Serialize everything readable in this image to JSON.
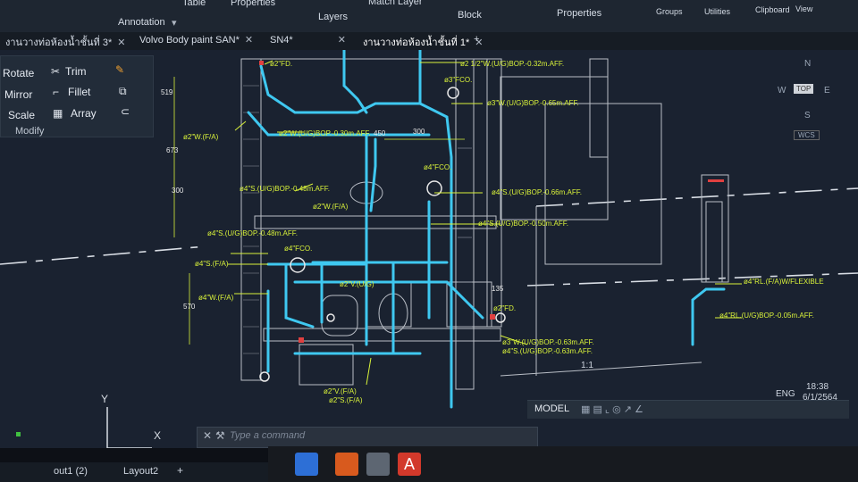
{
  "ribbon": {
    "groups": [
      "Annotation",
      "Layers",
      "Block",
      "Properties",
      "Groups",
      "Utilities",
      "Clipboard",
      "View"
    ],
    "top_items": [
      "Table",
      "Properties",
      "Match Layer"
    ]
  },
  "file_tabs": [
    {
      "label": "งานวางท่อห้องน้ำชั้นที่ 3*"
    },
    {
      "label": "Volvo Body paint SAN*"
    },
    {
      "label": "SN4*"
    },
    {
      "label": "งานวางท่อห้องน้ำชั้นที่ 1*"
    }
  ],
  "modify_panel": {
    "title": "Modify",
    "tools": [
      "Rotate",
      "Trim",
      "Mirror",
      "Fillet",
      "Scale",
      "Array"
    ]
  },
  "viewcube": {
    "n": "N",
    "w": "W",
    "e": "E",
    "s": "S",
    "top": "TOP",
    "wcs": "WCS"
  },
  "drawing": {
    "annotations_yellow": [
      "ø2\"FD.",
      "ø2 1/2\"W.(U/G)BOP.-0.32m.AFF.",
      "ø3\"FCO.",
      "ø3\"W.(U/G)BOP.-0.65m.AFF.",
      "ø2\"W.(F/A)",
      "ø2\"W.(U/G)BOP.-0.30m.AFF.",
      "ø4\"FCO.",
      "ø4\"S.(U/G)BOP.-0.48m.AFF.",
      "ø4\"S.(U/G)BOP.-0.66m.AFF.",
      "ø2\"W.(F/A)",
      "ø4\"S.(U/G)BOP.-0.48m.AFF.",
      "ø4\"S.(U/G)BOP.-0.50m.AFF.",
      "ø4\"FCO.",
      "ø4\"S.(F/A)",
      "ø2\"V.(U/G)",
      "ø4\"W.(F/A)",
      "ø2\"FD.",
      "ø3\"W.(U/G)BOP.-0.63m.AFF.",
      "ø4\"S.(U/G)BOP.-0.63m.AFF.",
      "ø2\"V.(F/A)",
      "ø2\"S.(F/A)",
      "ø4\"RL.(F/A)W/FLEXIBLE",
      "ø4\"RL.(U/G)BOP.-0.05m.AFF."
    ],
    "dimensions": [
      "519",
      "673",
      "450",
      "300",
      "300",
      "570",
      "135"
    ]
  },
  "command_line": {
    "placeholder": "Type a command"
  },
  "status_bar": {
    "model": "MODEL",
    "scale": "1:1"
  },
  "layout_tabs": [
    "out1 (2)",
    "Layout2",
    "+"
  ],
  "system_tray": {
    "lang": "ENG",
    "time": "18:38",
    "date": "6/1/2564"
  },
  "colors": {
    "pipe": "#3fc8f0",
    "annotation": "#d9f23a",
    "wall": "#c8c8c8",
    "background": "#1a2230"
  }
}
